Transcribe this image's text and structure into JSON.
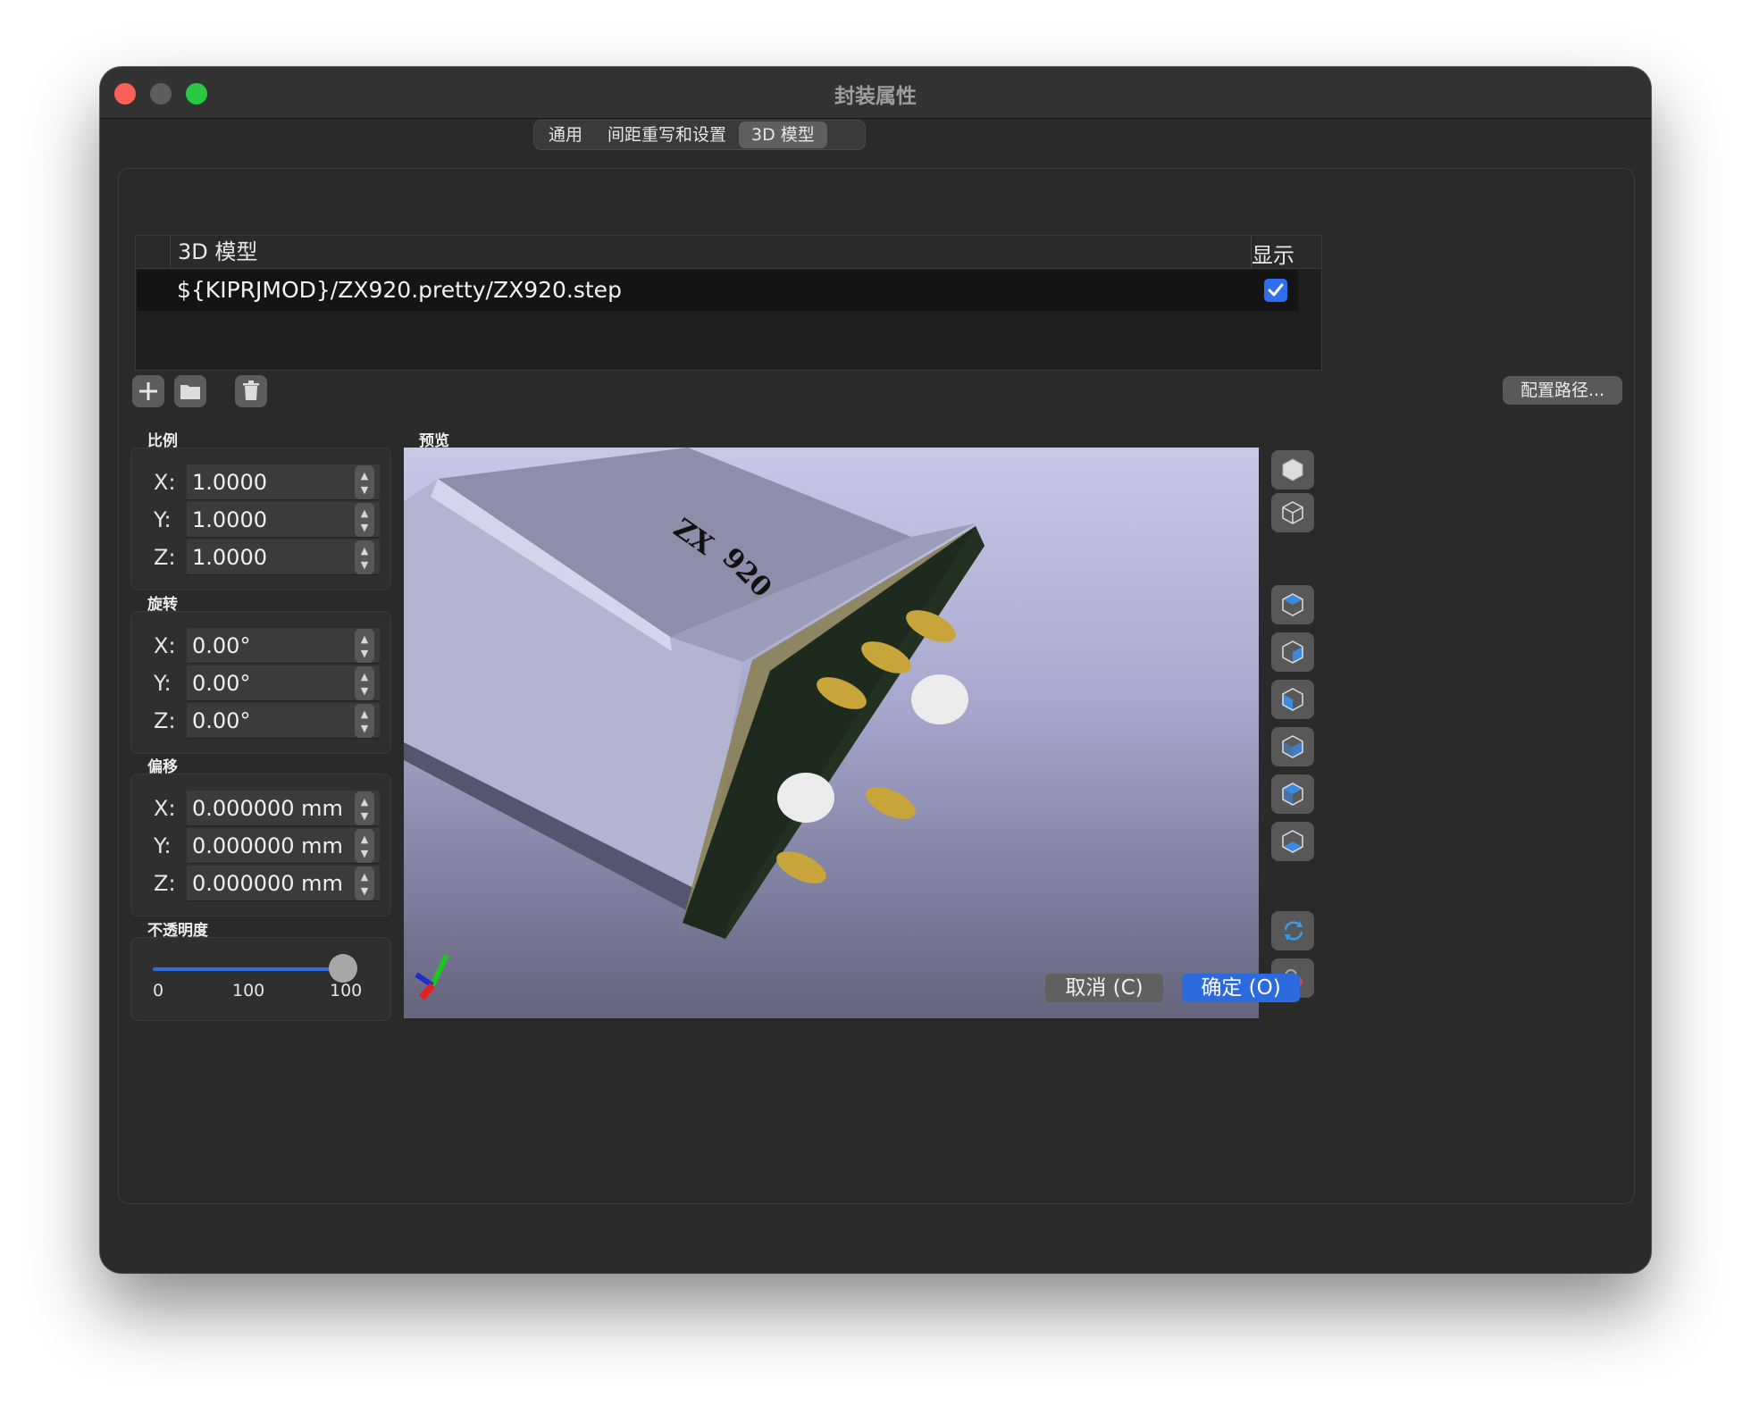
{
  "window": {
    "title": "封装属性"
  },
  "tabs": [
    {
      "label": "通用"
    },
    {
      "label": "间距重写和设置"
    },
    {
      "label": "3D 模型",
      "active": true
    }
  ],
  "models_table": {
    "col_model": "3D 模型",
    "col_show": "显示",
    "rows": [
      {
        "path": "${KIPRJMOD}/ZX920.pretty/ZX920.step",
        "show": true
      }
    ]
  },
  "toolbar": {
    "add_icon": "plus-icon",
    "browse_icon": "folder-icon",
    "delete_icon": "trash-icon",
    "config_label": "配置路径..."
  },
  "scale": {
    "label": "比例",
    "x_label": "X:",
    "x": "1.0000",
    "y_label": "Y:",
    "y": "1.0000",
    "z_label": "Z:",
    "z": "1.0000"
  },
  "rotation": {
    "label": "旋转",
    "x_label": "X:",
    "x": "0.00°",
    "y_label": "Y:",
    "y": "0.00°",
    "z_label": "Z:",
    "z": "0.00°"
  },
  "offset": {
    "label": "偏移",
    "x_label": "X:",
    "x": "0.000000 mm",
    "y_label": "Y:",
    "y": "0.000000 mm",
    "z_label": "Z:",
    "z": "0.000000 mm"
  },
  "opacity": {
    "label": "不透明度",
    "min": "0",
    "current": "100",
    "max": "100",
    "fraction": 1.0
  },
  "preview": {
    "label": "预览",
    "part_marking_1": "ZX",
    "part_marking_2": "920"
  },
  "view_buttons": [
    "view-3d-solid-icon",
    "view-3d-wire-icon",
    "view-top-icon",
    "view-bottom-icon",
    "view-left-icon",
    "view-right-icon",
    "view-front-icon",
    "view-back-icon",
    "reload-icon",
    "settings-icon"
  ],
  "buttons": {
    "cancel": "取消 (C)",
    "ok": "确定 (O)"
  },
  "colors": {
    "accent": "#2c6ae0",
    "window_bg": "#2b2b2b"
  }
}
